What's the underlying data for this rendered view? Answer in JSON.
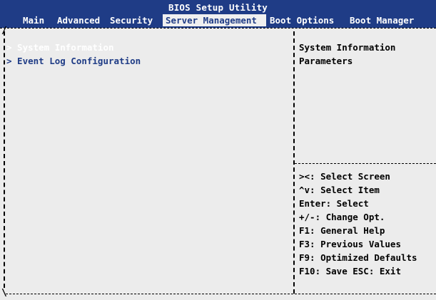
{
  "title": "BIOS Setup Utility",
  "menu": [
    {
      "label": "Main"
    },
    {
      "label": "Advanced"
    },
    {
      "label": "Security"
    },
    {
      "label": "Server Management"
    },
    {
      "label": "Boot Options"
    },
    {
      "label": "Boot Manager"
    }
  ],
  "active_menu": "Server Management",
  "items": [
    {
      "label": "> System Information"
    },
    {
      "label": "> Event Log Configuration"
    }
  ],
  "selected_item": "System Information",
  "help": {
    "description": [
      "System Information",
      "Parameters"
    ],
    "keys": [
      "><: Select Screen",
      "^v: Select Item",
      "Enter: Select",
      "+/-: Change Opt.",
      "F1: General Help",
      "F3: Previous Values",
      "F9: Optimized Defaults",
      "F10: Save  ESC: Exit"
    ]
  },
  "colors": {
    "header_bg": "#1f3c86",
    "screen_bg": "#ececec",
    "selected_text": "#ffffff",
    "item_text": "#1f3c86"
  }
}
